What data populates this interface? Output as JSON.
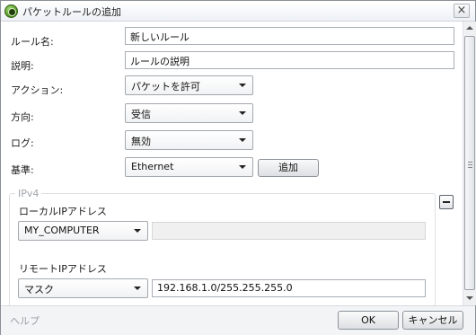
{
  "window": {
    "title": "パケットルールの追加",
    "close_label": "×"
  },
  "fields": {
    "rule_name": {
      "label": "ルール名:",
      "value": "新しいルール"
    },
    "description": {
      "label": "説明:",
      "value": "ルールの説明"
    },
    "action": {
      "label": "アクション:",
      "value": "パケットを許可"
    },
    "direction": {
      "label": "方向:",
      "value": "受信"
    },
    "log": {
      "label": "ログ:",
      "value": "無効"
    },
    "criteria": {
      "label": "基準:",
      "value": "Ethernet",
      "add_label": "追加"
    }
  },
  "ipv4": {
    "title": "IPv4",
    "local": {
      "label": "ローカルIPアドレス",
      "select_value": "MY_COMPUTER",
      "address_value": ""
    },
    "remote": {
      "label": "リモートIPアドレス",
      "select_value": "マスク",
      "address_value": "192.168.1.0/255.255.255.0"
    }
  },
  "footer": {
    "help_label": "ヘルプ",
    "ok_label": "OK",
    "cancel_label": "キャンセル"
  },
  "icons": {
    "app": "firewall-app-icon",
    "close": "close-icon",
    "collapse": "minus-icon",
    "dropdown": "chevron-down-icon"
  }
}
